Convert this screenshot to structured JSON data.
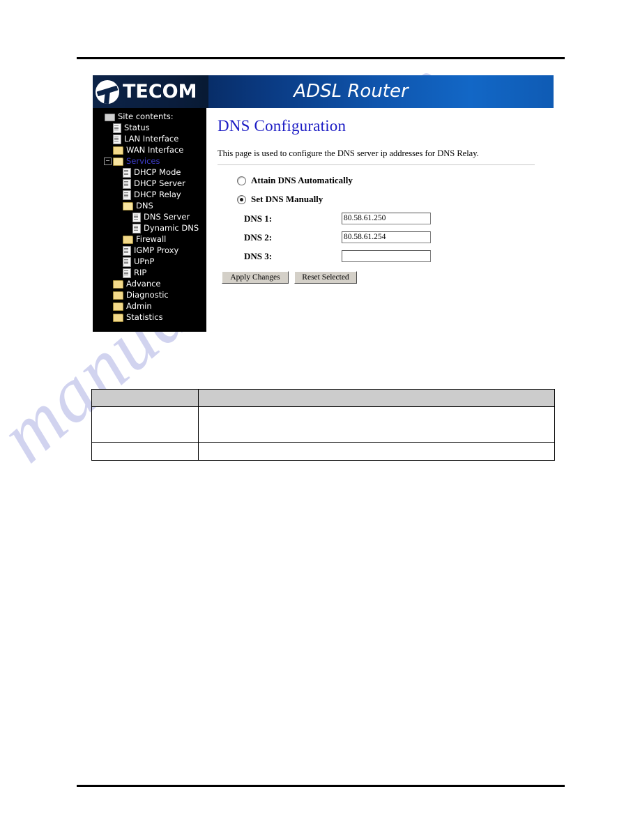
{
  "watermark": {
    "text": "manualshive.com"
  },
  "router_ui": {
    "brand": "TECOM",
    "banner_title": "ADSL Router",
    "sidebar": {
      "root_label": "Site contents:",
      "items": [
        {
          "label": "Site contents:",
          "level": 0,
          "icon": "computer-icon",
          "expander": "none",
          "state": "normal"
        },
        {
          "label": "Status",
          "level": 1,
          "icon": "page-icon",
          "expander": "none",
          "state": "normal"
        },
        {
          "label": "LAN Interface",
          "level": 1,
          "icon": "page-icon",
          "expander": "none",
          "state": "normal"
        },
        {
          "label": "WAN Interface",
          "level": 1,
          "icon": "folder-icon",
          "expander": "none",
          "state": "normal"
        },
        {
          "label": "Services",
          "level": 1,
          "icon": "folder-open-icon",
          "expander": "minus",
          "state": "active"
        },
        {
          "label": "DHCP Mode",
          "level": 2,
          "icon": "page-icon",
          "expander": "none",
          "state": "normal"
        },
        {
          "label": "DHCP Server",
          "level": 2,
          "icon": "page-icon",
          "expander": "none",
          "state": "normal"
        },
        {
          "label": "DHCP Relay",
          "level": 2,
          "icon": "page-icon",
          "expander": "none",
          "state": "normal"
        },
        {
          "label": "DNS",
          "level": 2,
          "icon": "folder-open-icon",
          "expander": "none",
          "state": "normal"
        },
        {
          "label": "DNS Server",
          "level": 3,
          "icon": "page-icon",
          "expander": "none",
          "state": "normal"
        },
        {
          "label": "Dynamic DNS",
          "level": 3,
          "icon": "page-icon",
          "expander": "none",
          "state": "normal"
        },
        {
          "label": "Firewall",
          "level": 2,
          "icon": "folder-icon",
          "expander": "none",
          "state": "normal"
        },
        {
          "label": "IGMP Proxy",
          "level": 2,
          "icon": "page-icon",
          "expander": "none",
          "state": "normal"
        },
        {
          "label": "UPnP",
          "level": 2,
          "icon": "page-icon",
          "expander": "none",
          "state": "normal"
        },
        {
          "label": "RIP",
          "level": 2,
          "icon": "page-icon",
          "expander": "none",
          "state": "normal"
        },
        {
          "label": "Advance",
          "level": 1,
          "icon": "folder-icon",
          "expander": "none",
          "state": "normal"
        },
        {
          "label": "Diagnostic",
          "level": 1,
          "icon": "folder-icon",
          "expander": "none",
          "state": "normal"
        },
        {
          "label": "Admin",
          "level": 1,
          "icon": "folder-icon",
          "expander": "none",
          "state": "normal"
        },
        {
          "label": "Statistics",
          "level": 1,
          "icon": "folder-icon",
          "expander": "none",
          "state": "normal"
        }
      ]
    },
    "main": {
      "heading": "DNS Configuration",
      "description": "This page is used to configure the DNS server ip addresses for DNS Relay.",
      "radios": [
        {
          "label": "Attain DNS Automatically",
          "checked": false
        },
        {
          "label": "Set DNS Manually",
          "checked": true
        }
      ],
      "fields": [
        {
          "label": "DNS 1:",
          "value": "80.58.61.250"
        },
        {
          "label": "DNS 2:",
          "value": "80.58.61.254"
        },
        {
          "label": "DNS 3:",
          "value": ""
        }
      ],
      "buttons": {
        "apply": "Apply Changes",
        "reset": "Reset Selected"
      }
    }
  },
  "description_table": {
    "header": [
      "",
      ""
    ],
    "rows": [
      [
        "",
        ""
      ],
      [
        "",
        ""
      ]
    ]
  },
  "colors": {
    "banner_dark": "#04183c",
    "banner_bright": "#1267c6",
    "heading_blue": "#1b1bc4",
    "active_link": "#3c3cc8",
    "sidebar_bg": "#000000",
    "table_header": "#cccccc",
    "watermark": "#c9cced"
  }
}
